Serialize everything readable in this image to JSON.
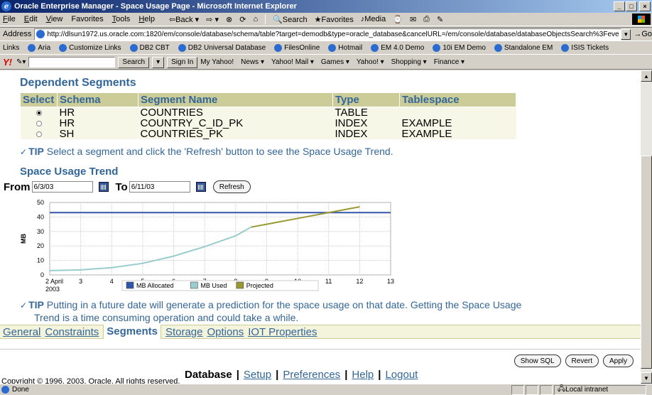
{
  "window": {
    "title": "Oracle Enterprise Manager - Space Usage Page - Microsoft Internet Explorer",
    "buttons": [
      "_",
      "□",
      "×"
    ]
  },
  "menu": {
    "items": [
      {
        "ul": "F",
        "rest": "ile"
      },
      {
        "ul": "E",
        "rest": "dit"
      },
      {
        "ul": "V",
        "rest": "iew"
      },
      {
        "ul": "",
        "rest": "Favorites"
      },
      {
        "ul": "T",
        "rest": "ools"
      },
      {
        "ul": "H",
        "rest": "elp"
      }
    ],
    "back": "⇦Back ▾",
    "forward": "⇨ ▾",
    "search": "Search",
    "favorites": "Favorites",
    "media": "Media"
  },
  "address": {
    "label": "Address",
    "url": "http://dlsun1972.us.oracle.com:1820/em/console/database/schema/table?target=demodb&type=oracle_database&cancelURL=/em/console/database/databaseObjectsSearch%3Feve",
    "go": "Go"
  },
  "links": {
    "label": "Links",
    "items": [
      "Aria",
      "Customize Links",
      "DB2 CBT",
      "DB2 Universal Database",
      "FilesOnline",
      "Hotmail",
      "EM 4.0 Demo",
      "10i EM Demo",
      "Standalone EM",
      "ISIS Tickets"
    ]
  },
  "yahoo": {
    "search": "Search",
    "signin": "Sign In",
    "items": [
      "My Yahoo!",
      "News ▾",
      "Yahoo! Mail ▾",
      "Games ▾",
      "Yahoo! ▾",
      "Shopping ▾",
      "Finance ▾"
    ]
  },
  "dependent": {
    "title": "Dependent Segments",
    "headers": [
      "Select",
      "Schema",
      "Segment Name",
      "Type",
      "Tablespace"
    ],
    "rows": [
      {
        "schema": "HR",
        "segment": "COUNTRIES",
        "type": "TABLE",
        "tablespace": "",
        "selected": true
      },
      {
        "schema": "HR",
        "segment": "COUNTRY_C_ID_PK",
        "type": "INDEX",
        "tablespace": "EXAMPLE",
        "selected": false
      },
      {
        "schema": "SH",
        "segment": "COUNTRIES_PK",
        "type": "INDEX",
        "tablespace": "EXAMPLE",
        "selected": false
      }
    ],
    "tip_label": "TIP",
    "tip": "Select a segment and click the 'Refresh' button to see the Space Usage Trend."
  },
  "trend": {
    "title": "Space Usage Trend",
    "from_label": "From",
    "from_value": "6/3/03",
    "to_label": "To",
    "to_value": "6/11/03",
    "refresh": "Refresh",
    "tip_label": "TIP",
    "tip_line1": "Putting in a future date will generate a prediction for the space usage on that date. Getting the Space Usage",
    "tip_line2": "Trend is a time consuming operation and could take a while."
  },
  "chart_data": {
    "type": "line",
    "ylabel": "MB",
    "ylim": [
      0,
      50
    ],
    "yticks": [
      0,
      10,
      20,
      30,
      40,
      50
    ],
    "xlim": [
      2,
      13
    ],
    "xticks": [
      2,
      3,
      4,
      5,
      6,
      7,
      8,
      9,
      10,
      11,
      12,
      13
    ],
    "xtick_labels": [
      "2 April",
      "3",
      "4",
      "5",
      "6",
      "7",
      "8",
      "9",
      "10",
      "11",
      "12",
      "13"
    ],
    "xsub_label": "2003",
    "series": [
      {
        "name": "MB Allocated",
        "color": "#3355aa",
        "x": [
          2,
          13
        ],
        "y": [
          43,
          43
        ]
      },
      {
        "name": "MB Used",
        "color": "#99cccc",
        "x": [
          2,
          3,
          4,
          5,
          6,
          7,
          8,
          8.5
        ],
        "y": [
          3,
          3.5,
          5,
          8,
          13,
          19.5,
          27,
          33
        ]
      },
      {
        "name": "Projected",
        "color": "#999933",
        "x": [
          8.5,
          9,
          10,
          11,
          12
        ],
        "y": [
          33,
          35,
          39,
          43,
          47
        ]
      }
    ],
    "grid": true,
    "legend": "bottom"
  },
  "tabs": {
    "items": [
      "General",
      "Constraints",
      "Segments",
      "Storage",
      "Options",
      "IOT Properties"
    ],
    "active": "Segments"
  },
  "actions": {
    "show_sql": "Show SQL",
    "revert": "Revert",
    "apply": "Apply"
  },
  "footer": {
    "database": "Database",
    "setup": "Setup",
    "preferences": "Preferences",
    "help": "Help",
    "logout": "Logout",
    "copyright": "Copyright © 1996, 2003, Oracle. All rights reserved."
  },
  "status": {
    "text": "Done",
    "zone": "Local intranet"
  }
}
